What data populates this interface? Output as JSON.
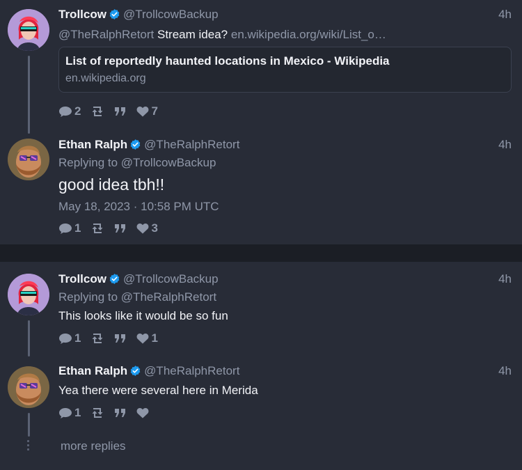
{
  "colors": {
    "background": "#282c37",
    "divider": "#1b1e25",
    "verified": "#1d9bf0",
    "muted": "#8f97a8",
    "text": "#f2f3f7"
  },
  "threads": [
    {
      "tweets": [
        {
          "name": "Trollcow",
          "handle": "@TrollcowBackup",
          "time": "4h",
          "mention": "@TheRalphRetort",
          "text": "Stream idea?",
          "link": "en.wikipedia.org/wiki/List_o…",
          "card": {
            "title": "List of reportedly haunted locations in Mexico - Wikipedia",
            "domain": "en.wikipedia.org"
          },
          "replies": "2",
          "likes": "7",
          "avatar_icon": "trollcow-avatar"
        },
        {
          "name": "Ethan Ralph",
          "handle": "@TheRalphRetort",
          "time": "4h",
          "replying_label": "Replying to",
          "replying_to": "@TrollcowBackup",
          "text": "good idea tbh!!",
          "date": "May 18, 2023 · 10:58 PM UTC",
          "replies": "1",
          "likes": "3",
          "avatar_icon": "ethan-avatar"
        }
      ]
    },
    {
      "tweets": [
        {
          "name": "Trollcow",
          "handle": "@TrollcowBackup",
          "time": "4h",
          "replying_label": "Replying to",
          "replying_to": "@TheRalphRetort",
          "text": "This looks like it would be so fun",
          "replies": "1",
          "likes": "1",
          "avatar_icon": "trollcow-avatar"
        },
        {
          "name": "Ethan Ralph",
          "handle": "@TheRalphRetort",
          "time": "4h",
          "text": "Yea there were several here in Merida",
          "replies": "1",
          "likes": "",
          "avatar_icon": "ethan-avatar"
        }
      ],
      "more_replies": "more replies"
    }
  ]
}
